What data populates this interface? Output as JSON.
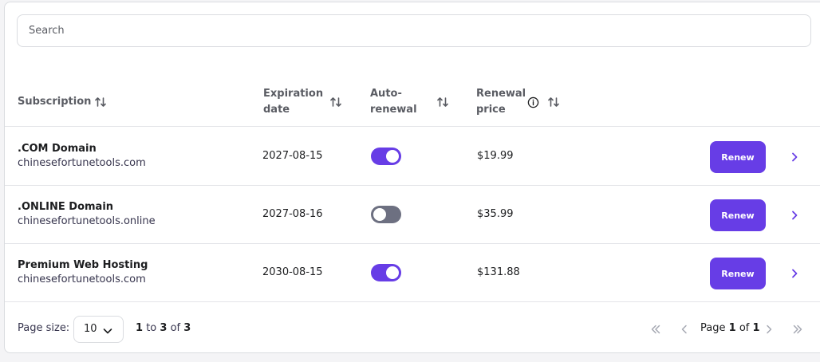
{
  "search": {
    "placeholder": "Search",
    "value": ""
  },
  "table": {
    "columns": {
      "subscription": "Subscription",
      "expiration_line1": "Expiration",
      "expiration_line2": "date",
      "autorenew_line1": "Auto-",
      "autorenew_line2": "renewal",
      "price_line1": "Renewal",
      "price_line2": "price"
    },
    "rows": [
      {
        "name": ".COM Domain",
        "domain": "chinesefortunetools.com",
        "expiration": "2027-08-15",
        "auto_renewal": true,
        "price": "$19.99",
        "action": "Renew"
      },
      {
        "name": ".ONLINE Domain",
        "domain": "chinesefortunetools.online",
        "expiration": "2027-08-16",
        "auto_renewal": false,
        "price": "$35.99",
        "action": "Renew"
      },
      {
        "name": "Premium Web Hosting",
        "domain": "chinesefortunetools.com",
        "expiration": "2030-08-15",
        "auto_renewal": true,
        "price": "$131.88",
        "action": "Renew"
      }
    ]
  },
  "footer": {
    "page_size_label": "Page size:",
    "page_size_value": "10",
    "range_from": "1",
    "range_to_word": "to",
    "range_to": "3",
    "range_of_word": "of",
    "range_total": "3",
    "page_word": "Page",
    "page_current": "1",
    "page_of_word": "of",
    "page_total": "1"
  },
  "icons": {
    "sort": "sort-arrows-icon",
    "info": "info-icon",
    "row_open": "chevron-right-icon",
    "page_size_dropdown": "chevron-down-icon",
    "first_page": "double-chevron-left-icon",
    "prev_page": "chevron-left-icon",
    "next_page": "chevron-right-icon",
    "last_page": "double-chevron-right-icon"
  },
  "colors": {
    "accent": "#673de6",
    "toggle_off": "#6d7081",
    "border": "#dadce0",
    "text": "#1d1e20",
    "muted": "#5a5c63"
  }
}
